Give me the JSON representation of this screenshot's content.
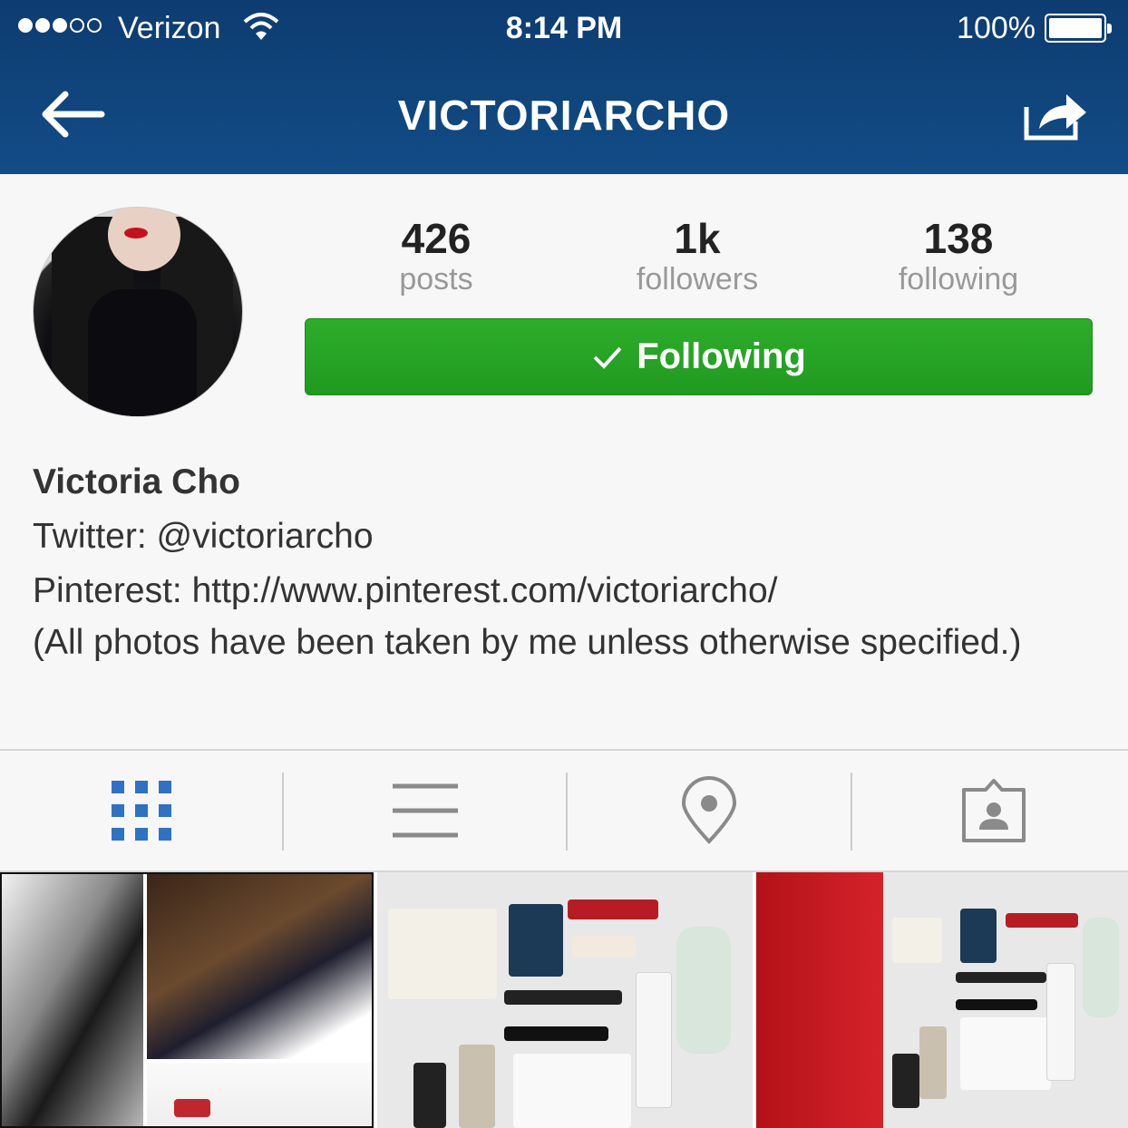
{
  "status_bar": {
    "carrier": "Verizon",
    "time": "8:14 PM",
    "battery": "100%",
    "signal_bars_filled": 3,
    "signal_bars_total": 5
  },
  "nav": {
    "title": "VICTORIARCHO",
    "back_icon": "arrow-left-icon",
    "share_icon": "share-icon"
  },
  "profile": {
    "stats": [
      {
        "value": "426",
        "label": "posts"
      },
      {
        "value": "1k",
        "label": "followers"
      },
      {
        "value": "138",
        "label": "following"
      }
    ],
    "follow_button": "Following",
    "name": "Victoria Cho",
    "bio_lines": [
      "Twitter: @victoriarcho",
      "Pinterest: http://www.pinterest.com/victoriarcho/",
      "(All photos have been taken by me unless otherwise specified.)"
    ]
  },
  "tabs": [
    {
      "icon": "grid-icon",
      "active": true
    },
    {
      "icon": "list-icon",
      "active": false
    },
    {
      "icon": "location-pin-icon",
      "active": false
    },
    {
      "icon": "tagged-photos-icon",
      "active": false
    }
  ],
  "colors": {
    "header": "#124c86",
    "follow_green": "#27a525",
    "active_tab": "#2f72c4",
    "inactive_tab": "#8a8a8a"
  }
}
